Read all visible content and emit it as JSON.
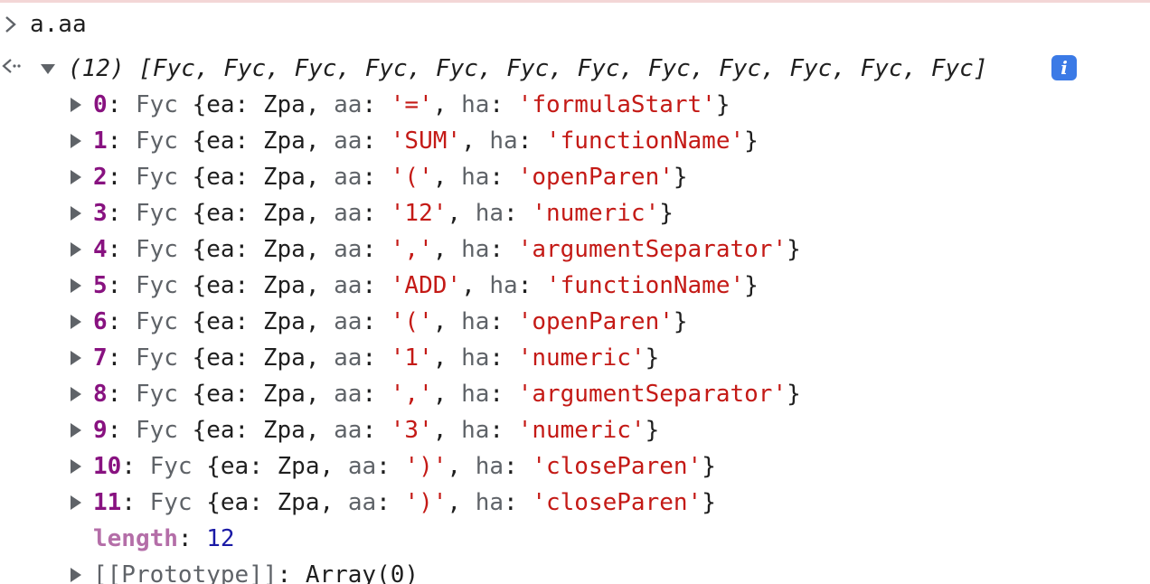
{
  "console": {
    "input_expression": "a.aa",
    "summary": {
      "count": "(12)",
      "preview": "[Fyc, Fyc, Fyc, Fyc, Fyc, Fyc, Fyc, Fyc, Fyc, Fyc, Fyc, Fyc]",
      "info_badge": "i"
    },
    "entries": [
      {
        "index": "0",
        "class": "Fyc",
        "ea": "Zpa",
        "aa": "'='",
        "ha": "'formulaStart'"
      },
      {
        "index": "1",
        "class": "Fyc",
        "ea": "Zpa",
        "aa": "'SUM'",
        "ha": "'functionName'"
      },
      {
        "index": "2",
        "class": "Fyc",
        "ea": "Zpa",
        "aa": "'('",
        "ha": "'openParen'"
      },
      {
        "index": "3",
        "class": "Fyc",
        "ea": "Zpa",
        "aa": "'12'",
        "ha": "'numeric'"
      },
      {
        "index": "4",
        "class": "Fyc",
        "ea": "Zpa",
        "aa": "','",
        "ha": "'argumentSeparator'"
      },
      {
        "index": "5",
        "class": "Fyc",
        "ea": "Zpa",
        "aa": "'ADD'",
        "ha": "'functionName'"
      },
      {
        "index": "6",
        "class": "Fyc",
        "ea": "Zpa",
        "aa": "'('",
        "ha": "'openParen'"
      },
      {
        "index": "7",
        "class": "Fyc",
        "ea": "Zpa",
        "aa": "'1'",
        "ha": "'numeric'"
      },
      {
        "index": "8",
        "class": "Fyc",
        "ea": "Zpa",
        "aa": "','",
        "ha": "'argumentSeparator'"
      },
      {
        "index": "9",
        "class": "Fyc",
        "ea": "Zpa",
        "aa": "'3'",
        "ha": "'numeric'"
      },
      {
        "index": "10",
        "class": "Fyc",
        "ea": "Zpa",
        "aa": "')'",
        "ha": "'closeParen'"
      },
      {
        "index": "11",
        "class": "Fyc",
        "ea": "Zpa",
        "aa": "')'",
        "ha": "'closeParen'"
      }
    ],
    "length_label": "length",
    "length_value": "12",
    "prototype_label": "[[Prototype]]",
    "prototype_value": "Array(0)"
  },
  "colors": {
    "index": "#881280",
    "string": "#c41a16",
    "number": "#1a1aa6",
    "muted_key": "#5f6368",
    "info_badge": "#3b7ae6"
  }
}
